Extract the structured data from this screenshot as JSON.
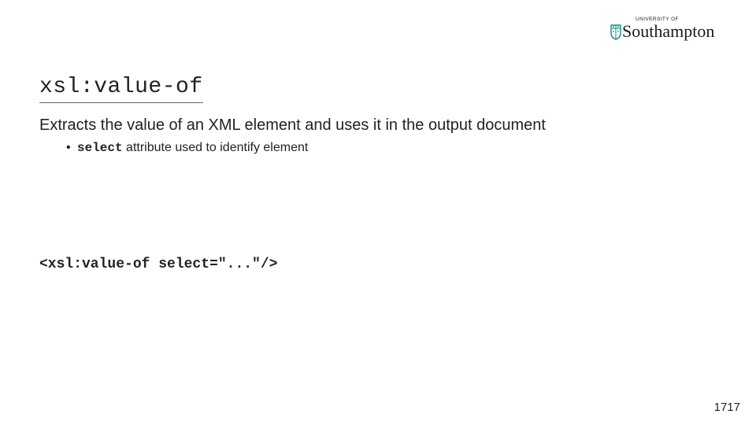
{
  "logo": {
    "prefix": "UNIVERSITY OF",
    "name": "Southampton",
    "accent_color": "#0b8f84",
    "text_color": "#1a1a1a"
  },
  "title": "xsl:value-of",
  "intro": "Extracts the value of an XML element and uses it in the output document",
  "bullet": {
    "code_word": "select",
    "rest": " attribute used to identify element"
  },
  "code_sample": "<xsl:value-of select=\"...\"/>",
  "page_number": "1717"
}
